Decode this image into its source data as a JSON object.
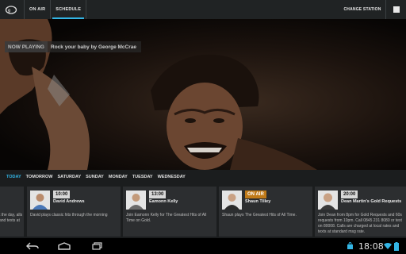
{
  "topbar": {
    "logo_icon": "gold-radio-logo",
    "tabs": [
      {
        "label": "ON AIR"
      },
      {
        "label": "SCHEDULE"
      }
    ],
    "active_tab": "SCHEDULE",
    "change_station_label": "CHANGE STATION",
    "overflow_icon": "menu-square-icon"
  },
  "now_playing": {
    "label": "NOW PLAYING",
    "track": "Rock your baby by George McCrae"
  },
  "days": {
    "items": [
      "TODAY",
      "TOMORROW",
      "SATURDAY",
      "SUNDAY",
      "MONDAY",
      "TUESDAY",
      "WEDNESDAY"
    ],
    "active": "TODAY",
    "active_color": "#33b5e5"
  },
  "schedule": {
    "partial_card": {
      "desc": "t the day, alls and texts at"
    },
    "cards": [
      {
        "time": "10:00",
        "presenter": "David Andrews",
        "desc": "David plays classic hits through the morning",
        "on_air": false
      },
      {
        "time": "13:00",
        "presenter": "Eamonn Kelly",
        "desc": "Join Eamonn Kelly for The Greatest Hits of All Time on Gold.",
        "on_air": false
      },
      {
        "time": "ON AIR",
        "presenter": "Shaun Tilley",
        "desc": "Shaun plays The Greatest Hits of All Time.",
        "on_air": true
      },
      {
        "time": "20:00",
        "presenter": "Dean Martin's Gold Requests",
        "desc": "Join Dean from 8pm for Gold Requests and 60s requests from 10pm. Call 0845 231 8080 or text on 80008. Calls are charged at local rates and texts at standard msg rate.",
        "on_air": false
      }
    ]
  },
  "navbar": {
    "back_icon": "back-icon",
    "home_icon": "home-icon",
    "recent_icon": "recent-apps-icon",
    "clock": "18:08",
    "status_icons": [
      "shopping-bag-icon",
      "wifi-icon",
      "battery-icon"
    ]
  },
  "colors": {
    "accent": "#33b5e5",
    "on_air_badge": "#c07a18",
    "actionbar": "#202324"
  }
}
